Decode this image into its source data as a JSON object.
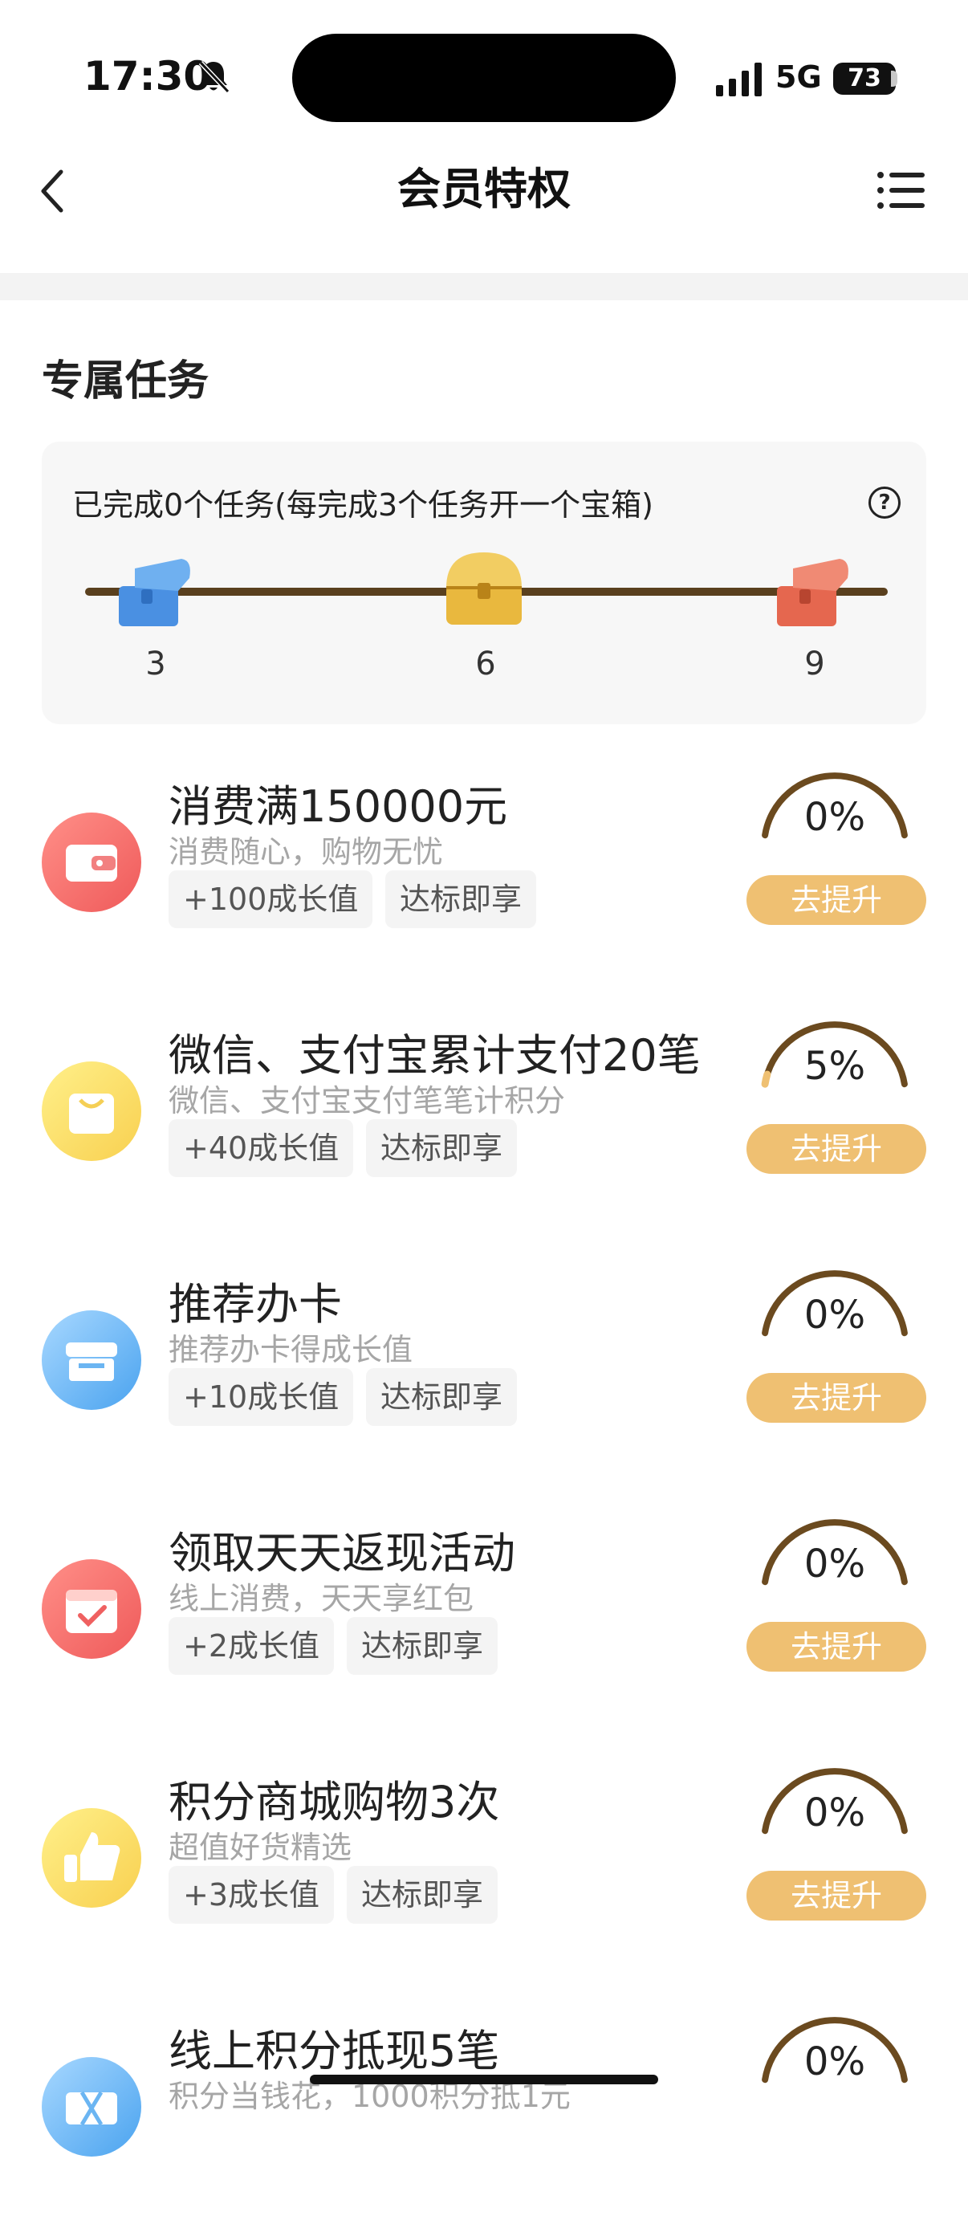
{
  "status_bar": {
    "time": "17:30",
    "network": "5G",
    "battery": "73"
  },
  "nav": {
    "title": "会员特权"
  },
  "section": {
    "title": "专属任务"
  },
  "progress": {
    "text": "已完成0个任务(每完成3个任务开一个宝箱)",
    "completed": 0,
    "milestones": [
      {
        "label": "3",
        "chest_color": "#4a90e2"
      },
      {
        "label": "6",
        "chest_color": "#e9b83e"
      },
      {
        "label": "9",
        "chest_color": "#e5674f"
      }
    ]
  },
  "tasks": [
    {
      "title": "消费满150000元",
      "subtitle": "消费随心，购物无忧",
      "reward": "+100成长值",
      "badge": "达标即享",
      "percent": "0%",
      "progress": 0,
      "button": "去提升",
      "icon": "wallet-icon"
    },
    {
      "title": "微信、支付宝累计支付20笔",
      "subtitle": "微信、支付宝支付笔笔计积分",
      "reward": "+40成长值",
      "badge": "达标即享",
      "percent": "5%",
      "progress": 0.05,
      "button": "去提升",
      "icon": "shopping-bag-icon"
    },
    {
      "title": "推荐办卡",
      "subtitle": "推荐办卡得成长值",
      "reward": "+10成长值",
      "badge": "达标即享",
      "percent": "0%",
      "progress": 0,
      "button": "去提升",
      "icon": "store-icon"
    },
    {
      "title": "领取天天返现活动",
      "subtitle": "线上消费，天天享红包",
      "reward": "+2成长值",
      "badge": "达标即享",
      "percent": "0%",
      "progress": 0,
      "button": "去提升",
      "icon": "calendar-check-icon"
    },
    {
      "title": "积分商城购物3次",
      "subtitle": "超值好货精选",
      "reward": "+3成长值",
      "badge": "达标即享",
      "percent": "0%",
      "progress": 0,
      "button": "去提升",
      "icon": "thumbs-up-icon"
    },
    {
      "title": "线上积分抵现5笔",
      "subtitle": "积分当钱花，1000积分抵1元",
      "reward": "",
      "badge": "",
      "percent": "0%",
      "progress": 0,
      "button": "",
      "icon": "ticket-icon"
    }
  ],
  "colors": {
    "accent": "#efc072",
    "gauge": "#6b4a1f",
    "track": "#5a401e"
  }
}
